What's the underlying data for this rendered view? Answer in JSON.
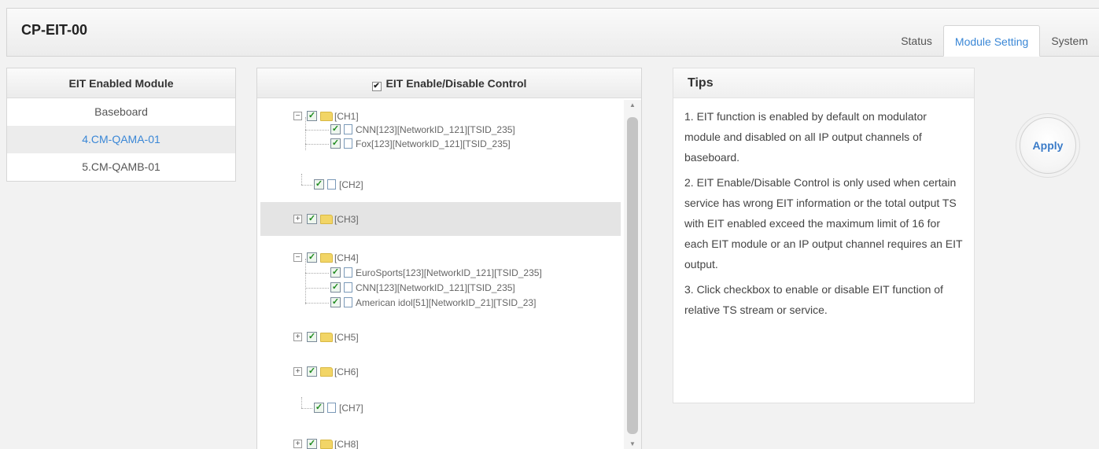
{
  "app": {
    "title": "CP-EIT-00"
  },
  "tabs": [
    {
      "label": "Status",
      "active": false
    },
    {
      "label": "Module Setting",
      "active": true
    },
    {
      "label": "System",
      "active": false
    }
  ],
  "modules": {
    "header": "EIT Enabled Module",
    "items": [
      {
        "label": "Baseboard",
        "selected": false
      },
      {
        "label": "4.CM-QAMA-01",
        "selected": true
      },
      {
        "label": "5.CM-QAMB-01",
        "selected": false
      }
    ]
  },
  "control": {
    "header": "EIT Enable/Disable Control",
    "header_checked": true,
    "channels": [
      {
        "label": "[CH1]",
        "checked": true,
        "expanded": true,
        "services": [
          {
            "label": "CNN[123][NetworkID_121][TSID_235]",
            "checked": true
          },
          {
            "label": "Fox[123][NetworkID_121][TSID_235]",
            "checked": true
          }
        ]
      },
      {
        "label": "[CH2]",
        "checked": true,
        "leaf": true
      },
      {
        "label": "[CH3]",
        "checked": true,
        "expanded": false,
        "highlighted": true
      },
      {
        "label": "[CH4]",
        "checked": true,
        "expanded": true,
        "services": [
          {
            "label": "EuroSports[123][NetworkID_121][TSID_235]",
            "checked": true
          },
          {
            "label": "CNN[123][NetworkID_121][TSID_235]",
            "checked": true
          },
          {
            "label": "American idol[51][NetworkID_21][TSID_23]",
            "checked": true
          }
        ]
      },
      {
        "label": "[CH5]",
        "checked": true,
        "expanded": false
      },
      {
        "label": "[CH6]",
        "checked": true,
        "expanded": false
      },
      {
        "label": "[CH7]",
        "checked": true,
        "leaf": true
      },
      {
        "label": "[CH8]",
        "checked": true,
        "expanded": false
      }
    ]
  },
  "tips": {
    "header": "Tips",
    "items": [
      "1. EIT function is enabled by default on modulator module and disabled on all IP output channels of baseboard.",
      "2. EIT Enable/Disable Control is only used when certain service has wrong EIT information or the total output TS with EIT enabled exceed the maximum limit of 16 for each EIT module or an IP output channel requires an EIT output.",
      "3. Click checkbox to enable or disable EIT function of relative TS stream or service."
    ]
  },
  "apply_label": "Apply",
  "icons": {
    "collapse": "minus-box-icon",
    "expand": "plus-box-icon",
    "checkbox": "checkbox-checked-icon",
    "folder": "folder-icon",
    "file": "file-icon"
  },
  "colors": {
    "accent": "#3a87d6",
    "check": "#1d8a1d",
    "folder": "#f2d566"
  }
}
